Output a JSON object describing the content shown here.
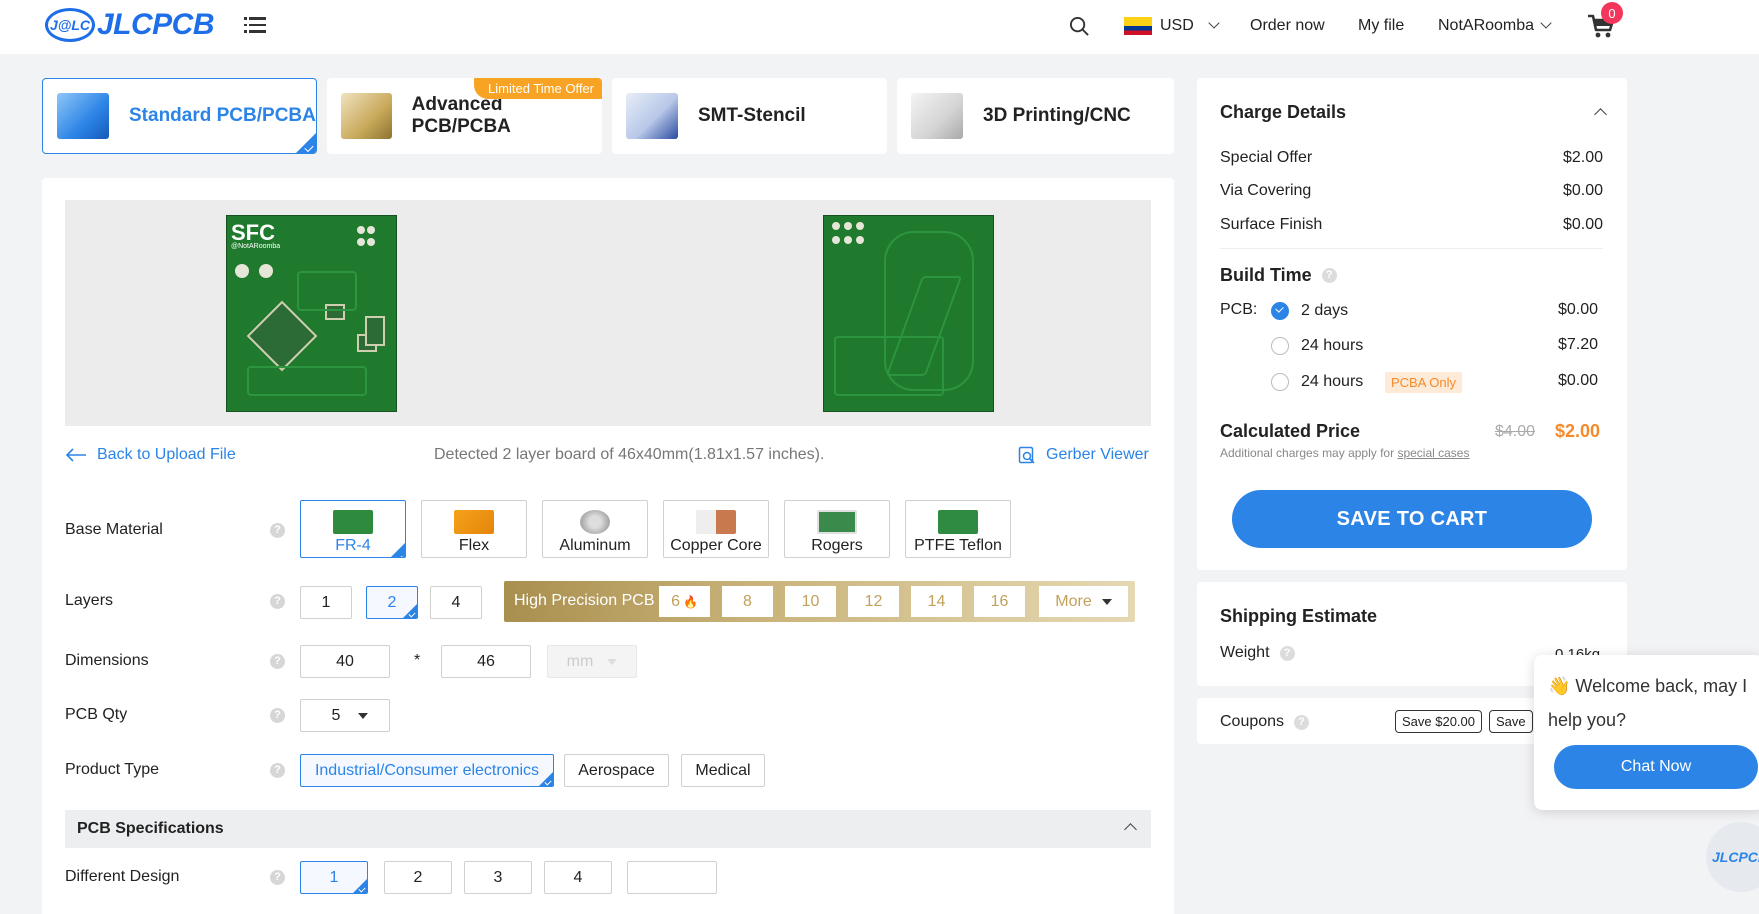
{
  "header": {
    "logo_badge": "J@LC",
    "logo_text": "JLCPCB",
    "currency": "USD",
    "order_now": "Order now",
    "my_file": "My file",
    "user": "NotARoomba",
    "cart_count": "0"
  },
  "product_tabs": [
    {
      "label": "Standard PCB/PCBA",
      "active": true
    },
    {
      "label": "Advanced PCB/PCBA",
      "badge": "Limited Time Offer"
    },
    {
      "label": "SMT-Stencil"
    },
    {
      "label": "3D Printing/CNC"
    }
  ],
  "preview": {
    "silk_text": "SFC",
    "silk_sub": "@NotARoomba"
  },
  "upload": {
    "back_label": "Back to Upload File",
    "detected": "Detected 2 layer board of 46x40mm(1.81x1.57 inches).",
    "gerber_viewer": "Gerber Viewer"
  },
  "form": {
    "base_material": {
      "label": "Base Material",
      "options": [
        "FR-4",
        "Flex",
        "Aluminum",
        "Copper Core",
        "Rogers",
        "PTFE Teflon"
      ],
      "selected": "FR-4"
    },
    "layers": {
      "label": "Layers",
      "options": [
        "1",
        "2",
        "4"
      ],
      "selected": "2",
      "high_precision_label": "High Precision PCB",
      "high_precision_options": [
        "6",
        "8",
        "10",
        "12",
        "14",
        "16"
      ],
      "more_label": "More"
    },
    "dimensions": {
      "label": "Dimensions",
      "width": "40",
      "separator": "*",
      "height": "46",
      "unit": "mm"
    },
    "qty": {
      "label": "PCB Qty",
      "value": "5"
    },
    "product_type": {
      "label": "Product Type",
      "options": [
        "Industrial/Consumer electronics",
        "Aerospace",
        "Medical"
      ],
      "selected": "Industrial/Consumer electronics"
    },
    "spec_header": "PCB Specifications",
    "different_design": {
      "label": "Different Design",
      "options": [
        "1",
        "2",
        "3",
        "4",
        ""
      ],
      "selected": "1"
    }
  },
  "charge": {
    "title": "Charge Details",
    "items": [
      {
        "label": "Special Offer",
        "value": "$2.00"
      },
      {
        "label": "Via Covering",
        "value": "$0.00"
      },
      {
        "label": "Surface Finish",
        "value": "$0.00"
      }
    ],
    "build_time_title": "Build Time",
    "pcb_label": "PCB:",
    "build_options": [
      {
        "label": "2 days",
        "price": "$0.00",
        "selected": true
      },
      {
        "label": "24 hours",
        "price": "$7.20"
      },
      {
        "label": "24 hours",
        "price": "$0.00",
        "tag": "PCBA Only"
      }
    ],
    "calc_title": "Calculated Price",
    "old_price": "$4.00",
    "new_price": "$2.00",
    "additional_text": "Additional charges may apply for",
    "special_cases": "special cases",
    "save_to_cart": "SAVE TO CART"
  },
  "shipping": {
    "title": "Shipping Estimate",
    "weight_label": "Weight",
    "weight_value": "0.16kg"
  },
  "coupons": {
    "label": "Coupons",
    "items": [
      "Save $20.00",
      "Save"
    ]
  },
  "chat": {
    "message": "👋 Welcome back, may I help you?",
    "button": "Chat Now",
    "avatar_text": "JLCPCB"
  },
  "colors": {
    "accent": "#2c84e6",
    "price_orange": "#f58a2a",
    "board_green": "#1f7a2e",
    "gold": "#c2a05a"
  }
}
